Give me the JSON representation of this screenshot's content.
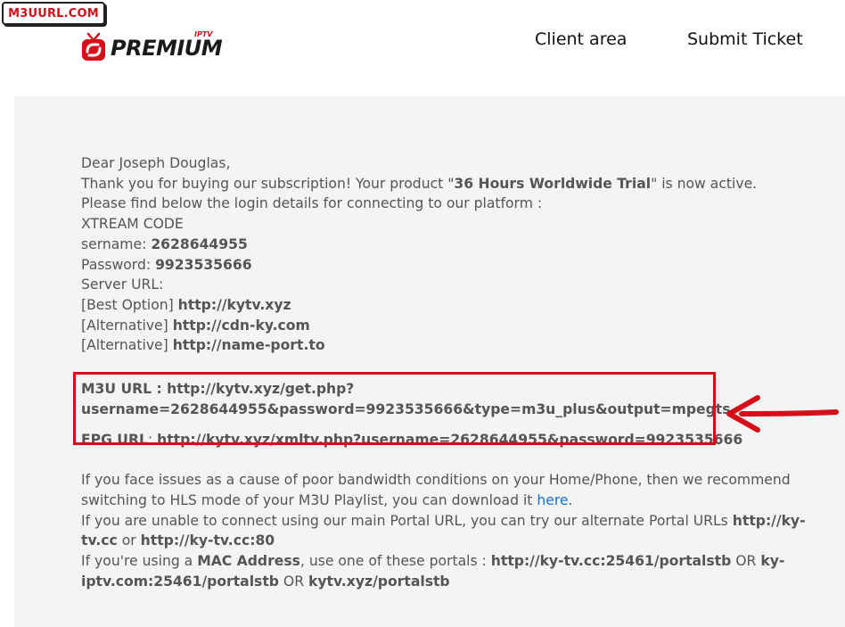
{
  "badge": {
    "text": "M3UURL.COM"
  },
  "logo": {
    "word": "PREMIUM",
    "sup": "IPTV"
  },
  "nav": {
    "client": "Client area",
    "ticket": "Submit Ticket"
  },
  "email": {
    "greeting": "Dear Joseph Douglas,",
    "thanks_pre": "Thank you for buying our subscription! Your product \"",
    "product": "36 Hours Worldwide Trial",
    "thanks_post": "\" is now active.",
    "find_below": "Please find below the login details for connecting to our platform :",
    "xtream": "XTREAM CODE",
    "username_label": "sername:",
    "username": "2628644955",
    "password_label": "Password:",
    "password": "9923535666",
    "server_label": "Server URL:",
    "best_label": "[Best Option]",
    "best_url": "http://kytv.xyz",
    "alt1_label": "[Alternative]",
    "alt1_url": "http://cdn-ky.com",
    "alt2_label": "[Alternative]",
    "alt2_url": "http://name-port.to",
    "m3u_line1": "M3U URL : http://kytv.xyz/get.php?",
    "m3u_line2": "username=2628644955&password=9923535666&type=m3u_plus&output=mpegts",
    "epg_label": "EPG URL",
    "epg_sep": ":",
    "epg_url": "http://kytv.xyz/xmltv.php?username=2628644955&password=9923535666",
    "hls_line1": "If you face issues as a cause of poor bandwidth conditions on your Home/Phone, then we recommend",
    "hls_line2_pre": "switching to HLS mode of your M3U Playlist, you can download it",
    "hls_link": "here",
    "hls_line2_post": ".",
    "portal_pre": "If you are unable to connect using our main Portal URL, you can try our alternate Portal URLs",
    "portal_url1a": "http://ky-",
    "portal_url1b": "tv.cc",
    "portal_or": "or",
    "portal_url2": "http://ky-tv.cc:80",
    "mac_pre": "If you're using a",
    "mac_bold": "MAC Address",
    "mac_mid": ", use one of these portals :",
    "mac_url1": "http://ky-tv.cc:25461/portalstb",
    "mac_or1": "OR",
    "mac_url2a": "ky-",
    "mac_url2b": "iptv.com:25461/portalstb",
    "mac_or2": "OR",
    "mac_url3": "kytv.xyz/portalstb"
  },
  "colors": {
    "accent_red": "#d40f1a",
    "link_blue": "#1a6fd6",
    "panel_bg": "#f4f4f4",
    "text_gray": "#555555"
  }
}
